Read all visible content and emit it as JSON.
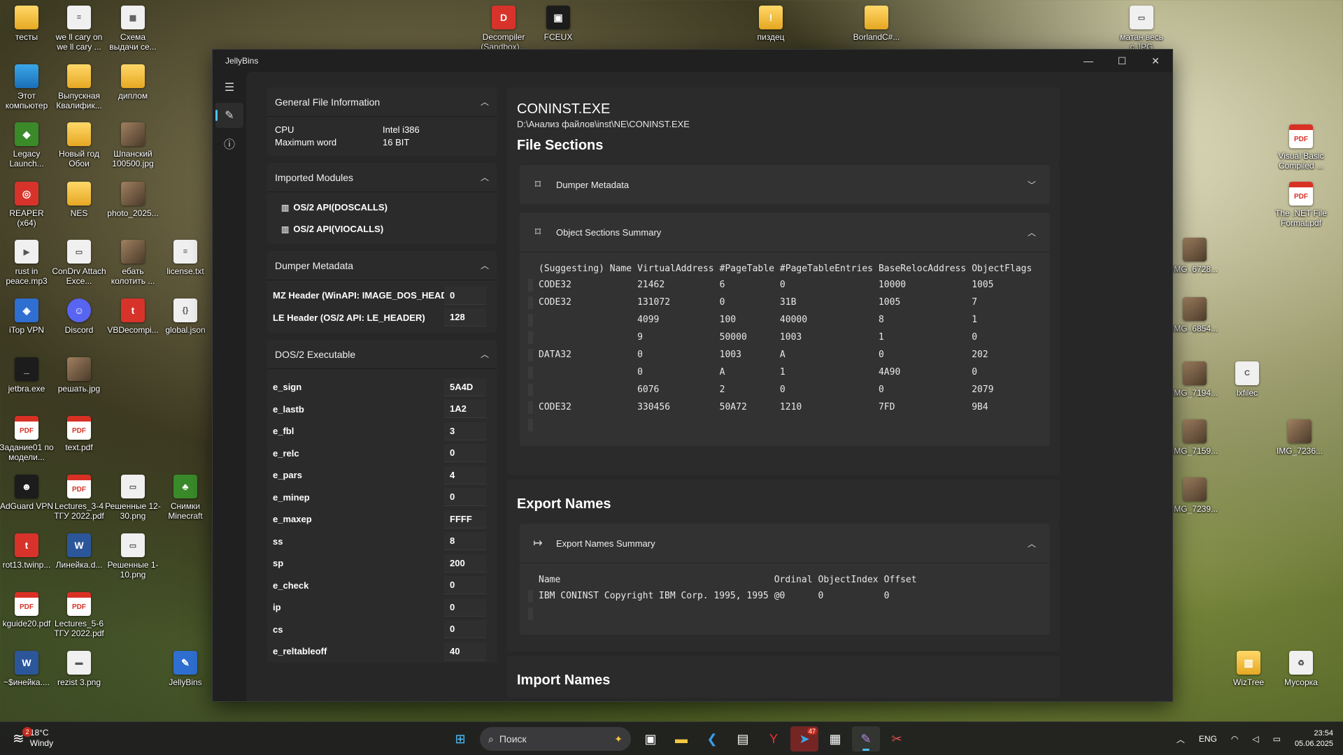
{
  "desktop": {
    "icons": [
      {
        "label": "тесты",
        "kind": "folder",
        "glyph": ""
      },
      {
        "label": "we ll cary on we ll cary ...",
        "kind": "file",
        "glyph": "≡"
      },
      {
        "label": "Схема выдачи се...",
        "kind": "file",
        "glyph": "▦"
      },
      {
        "label": "Этот компьютер",
        "kind": "monitor",
        "glyph": ""
      },
      {
        "label": "Выпускная Квалифик...",
        "kind": "folder",
        "glyph": ""
      },
      {
        "label": "диплом",
        "kind": "folder",
        "glyph": ""
      },
      {
        "label": "Legacy Launch...",
        "kind": "green",
        "glyph": "◆"
      },
      {
        "label": "Новый год Обои",
        "kind": "folder",
        "glyph": ""
      },
      {
        "label": "Шпанский 100500.jpg",
        "kind": "img",
        "glyph": ""
      },
      {
        "label": "REAPER (x64)",
        "kind": "red",
        "glyph": "◎"
      },
      {
        "label": "NES",
        "kind": "folder",
        "glyph": ""
      },
      {
        "label": "photo_2025...",
        "kind": "img",
        "glyph": ""
      },
      {
        "label": "rust in peace.mp3",
        "kind": "file",
        "glyph": "▶"
      },
      {
        "label": "ConDrv Attach Exce...",
        "kind": "file",
        "glyph": "▭"
      },
      {
        "label": "ебать колотить ...",
        "kind": "img",
        "glyph": ""
      },
      {
        "label": "license.txt",
        "kind": "file",
        "glyph": "≡"
      },
      {
        "label": "iTop VPN",
        "kind": "blue",
        "glyph": "◈"
      },
      {
        "label": "Discord",
        "kind": "discord",
        "glyph": "☺"
      },
      {
        "label": "VBDecompi...",
        "kind": "red",
        "glyph": "t"
      },
      {
        "label": "global.json",
        "kind": "file",
        "glyph": "{}"
      },
      {
        "label": "jetbra.exe",
        "kind": "app",
        "glyph": "_"
      },
      {
        "label": "решать.jpg",
        "kind": "img",
        "glyph": ""
      },
      {
        "label": "Задание01 по модели...",
        "kind": "pdf",
        "glyph": "PDF"
      },
      {
        "label": "text.pdf",
        "kind": "pdf",
        "glyph": "PDF"
      },
      {
        "label": "AdGuard VPN",
        "kind": "app",
        "glyph": "☻"
      },
      {
        "label": "Lectures_3-4 ТГУ 2022.pdf",
        "kind": "pdf",
        "glyph": "PDF"
      },
      {
        "label": "Решенные 12-30.png",
        "kind": "file",
        "glyph": "▭"
      },
      {
        "label": "Снимки Minecraft",
        "kind": "green",
        "glyph": "♣"
      },
      {
        "label": "rot13.twinp...",
        "kind": "red",
        "glyph": "t"
      },
      {
        "label": "Линейка.d...",
        "kind": "word",
        "glyph": "W"
      },
      {
        "label": "Решенные 1-10.png",
        "kind": "file",
        "glyph": "▭"
      },
      {
        "label": "kguide20.pdf",
        "kind": "pdf",
        "glyph": "PDF"
      },
      {
        "label": "Lectures_5-6 ТГУ 2022.pdf",
        "kind": "pdf",
        "glyph": "PDF"
      },
      {
        "label": "~$инейка....",
        "kind": "word",
        "glyph": "W"
      },
      {
        "label": "rezist 3.png",
        "kind": "file",
        "glyph": "▬"
      },
      {
        "label": "JellyBins",
        "kind": "blue",
        "glyph": "✎"
      },
      {
        "label": "Decompiler (Sandbox)...",
        "kind": "red",
        "glyph": "D"
      },
      {
        "label": "FCEUX",
        "kind": "app",
        "glyph": "▣"
      },
      {
        "label": "пиздец",
        "kind": "folder",
        "glyph": "!"
      },
      {
        "label": "BorlandC#...",
        "kind": "folder",
        "glyph": ""
      },
      {
        "label": "матан весь с.JPG",
        "kind": "file",
        "glyph": "▭"
      },
      {
        "label": "Visual Basic Compiled ...",
        "kind": "pdf",
        "glyph": "PDF"
      },
      {
        "label": "The .NET File Format.pdf",
        "kind": "pdf",
        "glyph": "PDF"
      },
      {
        "label": "IMG_6728...",
        "kind": "img",
        "glyph": ""
      },
      {
        "label": "IMG_6854...",
        "kind": "img",
        "glyph": ""
      },
      {
        "label": "IMG_7194...",
        "kind": "img",
        "glyph": ""
      },
      {
        "label": "lxfilec",
        "kind": "file",
        "glyph": "C"
      },
      {
        "label": "IMG_7159...",
        "kind": "img",
        "glyph": ""
      },
      {
        "label": "IMG_7236...",
        "kind": "img",
        "glyph": ""
      },
      {
        "label": "IMG_7239...",
        "kind": "img",
        "glyph": ""
      },
      {
        "label": "WizTree",
        "kind": "folder",
        "glyph": "▥"
      },
      {
        "label": "Мусорка",
        "kind": "file",
        "glyph": "♻"
      }
    ]
  },
  "window": {
    "title": "JellyBins",
    "controls": {
      "minimize": "—",
      "maximize": "☐",
      "close": "✕"
    },
    "nav": {
      "menu": "☰",
      "edit": "✎",
      "info": "ⓘ"
    }
  },
  "general_info": {
    "header": "General File Information",
    "rows": [
      {
        "key": "CPU",
        "value": "Intel i386"
      },
      {
        "key": "Maximum word",
        "value": "16 BIT"
      }
    ]
  },
  "imported_modules": {
    "header": "Imported Modules",
    "items": [
      "OS/2 API(DOSCALLS)",
      "OS/2 API(VIOCALLS)"
    ]
  },
  "dumper_metadata_left": {
    "header": "Dumper Metadata",
    "rows": [
      {
        "key": "MZ Header (WinAPI: IMAGE_DOS_HEADER)",
        "value": "0"
      },
      {
        "key": "LE Header (OS/2 API: LE_HEADER)",
        "value": "128"
      }
    ]
  },
  "dos2_exec": {
    "header": "DOS/2 Executable",
    "rows": [
      {
        "key": "e_sign",
        "value": "5A4D"
      },
      {
        "key": "e_lastb",
        "value": "1A2"
      },
      {
        "key": "e_fbl",
        "value": "3"
      },
      {
        "key": "e_relc",
        "value": "0"
      },
      {
        "key": "e_pars",
        "value": "4"
      },
      {
        "key": "e_minep",
        "value": "0"
      },
      {
        "key": "e_maxep",
        "value": "FFFF"
      },
      {
        "key": "ss",
        "value": "8"
      },
      {
        "key": "sp",
        "value": "200"
      },
      {
        "key": "e_check",
        "value": "0"
      },
      {
        "key": "ip",
        "value": "0"
      },
      {
        "key": "cs",
        "value": "0"
      },
      {
        "key": "e_reltableoff",
        "value": "40"
      }
    ]
  },
  "file": {
    "name": "CONINST.EXE",
    "path": "D:\\Анализ файлов\\inst\\NE\\CONINST.EXE"
  },
  "file_sections": {
    "title": "File Sections",
    "dumper_header": "Dumper Metadata",
    "objects_header": "Object Sections Summary",
    "columns": [
      "(Suggesting) Name",
      "VirtualAddress",
      "#PageTable",
      "#PageTableEntries",
      "BaseRelocAddress",
      "ObjectFlags"
    ],
    "rows": [
      [
        "CODE32",
        "21462",
        "6",
        "0",
        "10000",
        "1005"
      ],
      [
        "CODE32",
        "131072",
        "0",
        "31B",
        "1005",
        "7"
      ],
      [
        "",
        "4099",
        "100",
        "40000",
        "8",
        "1"
      ],
      [
        "",
        "9",
        "50000",
        "1003",
        "1",
        "0"
      ],
      [
        "DATA32",
        "0",
        "1003",
        "A",
        "0",
        "202"
      ],
      [
        "",
        "0",
        "A",
        "1",
        "4A90",
        "0"
      ],
      [
        "",
        "6076",
        "2",
        "0",
        "0",
        "2079"
      ],
      [
        "CODE32",
        "330456",
        "50A72",
        "1210",
        "7FD",
        "9B4"
      ]
    ]
  },
  "export_names": {
    "title": "Export Names",
    "summary_header": "Export Names Summary",
    "columns": [
      "Name",
      "Ordinal",
      "ObjectIndex",
      "Offset"
    ],
    "rows": [
      [
        "IBM CONINST Copyright IBM Corp. 1995, 1995",
        "@0",
        "0",
        "0"
      ]
    ]
  },
  "import_names": {
    "title": "Import Names"
  },
  "taskbar": {
    "weather_temp": "18°C",
    "weather_desc": "Windy",
    "weather_badge": "2",
    "search_placeholder": "Поиск",
    "telegram_badge": "47",
    "lang": "ENG",
    "time": "23:54",
    "date": "05.06.2025"
  },
  "colors": {
    "accent": "#4cc2ff",
    "window_bg": "#202020",
    "card_bg": "#2b2b2b"
  }
}
